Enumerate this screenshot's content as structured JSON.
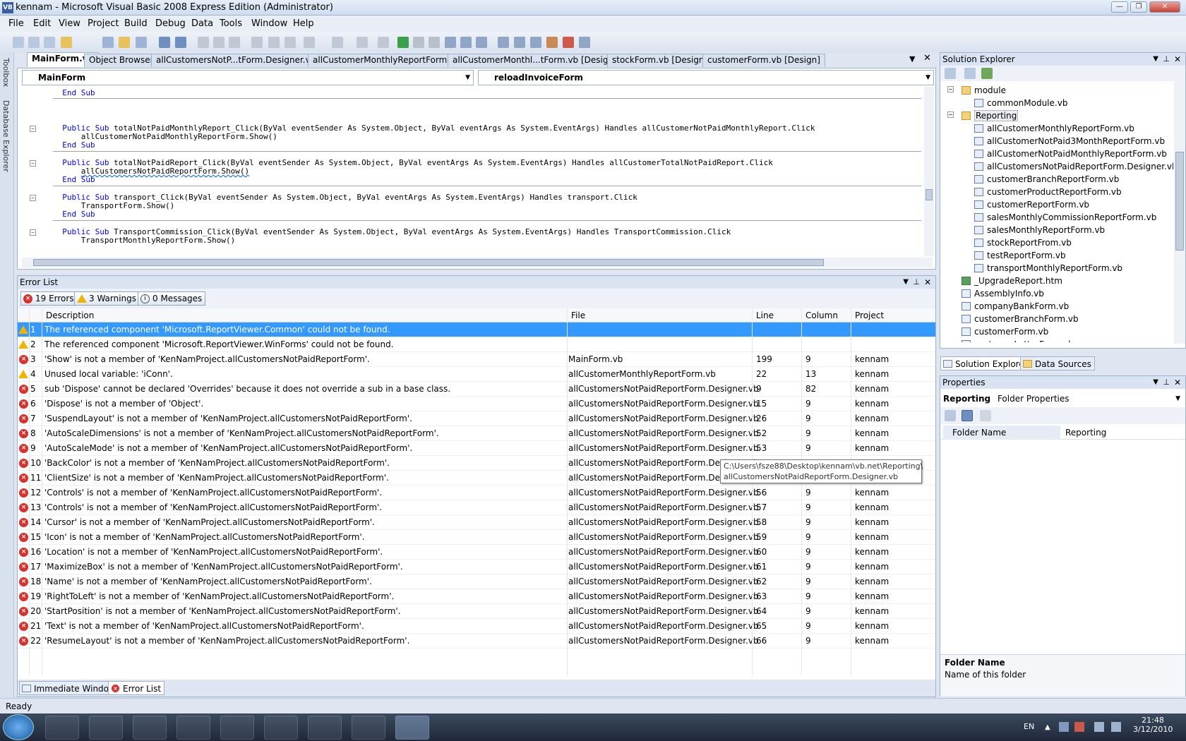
{
  "window": {
    "title": "kennam - Microsoft Visual Basic 2008 Express Edition (Administrator)",
    "app_icon": "VB",
    "minimize": "—",
    "maximize": "❐",
    "close": "✕"
  },
  "menu": [
    "File",
    "Edit",
    "View",
    "Project",
    "Build",
    "Debug",
    "Data",
    "Tools",
    "Window",
    "Help"
  ],
  "side_strip": {
    "toolbox": "Toolbox",
    "database_explorer": "Database Explorer"
  },
  "doc_tabs": [
    "MainForm.vb",
    "Object Browser",
    "allCustomersNotP...tForm.Designer.vb",
    "allCustomerMonthlyReportForm.vb",
    "allCustomerMonthl...tForm.vb [Design]",
    "stockForm.vb [Design]",
    "customerForm.vb [Design]"
  ],
  "editor": {
    "class_combo": "MainForm",
    "method_combo": "reloadInvoiceForm",
    "lines": [
      {
        "pre": "  ",
        "kw": "End Sub",
        "post": ""
      },
      {
        "pre": "  ",
        "kw": "Public Sub",
        "post": " totalNotPaidMonthlyReport_Click(ByVal eventSender As System.Object, ByVal eventArgs As System.EventArgs) Handles allCustomerNotPaidMonthlyReport.Click"
      },
      {
        "pre": "      ",
        "kw": "",
        "post": "allCustomerNotPaidMonthlyReportForm.Show()"
      },
      {
        "pre": "  ",
        "kw": "End Sub",
        "post": ""
      },
      {
        "pre": "  ",
        "kw": "Public Sub",
        "post": " totalNotPaidReport_Click(ByVal eventSender As System.Object, ByVal eventArgs As System.EventArgs) Handles allCustomerTotalNotPaidReport.Click"
      },
      {
        "pre": "      ",
        "kw": "",
        "post": "allCustomersNotPaidReportForm.Show()"
      },
      {
        "pre": "  ",
        "kw": "End Sub",
        "post": ""
      },
      {
        "pre": "  ",
        "kw": "Public Sub",
        "post": " transport_Click(ByVal eventSender As System.Object, ByVal eventArgs As System.EventArgs) Handles transport.Click"
      },
      {
        "pre": "      ",
        "kw": "",
        "post": "TransportForm.Show()"
      },
      {
        "pre": "  ",
        "kw": "End Sub",
        "post": ""
      },
      {
        "pre": "  ",
        "kw": "Public Sub",
        "post": " TransportCommission_Click(ByVal eventSender As System.Object, ByVal eventArgs As System.EventArgs) Handles TransportCommission.Click"
      },
      {
        "pre": "      ",
        "kw": "",
        "post": "TransportMonthlyReportForm.Show()"
      }
    ]
  },
  "error_list": {
    "title": "Error List",
    "filters": {
      "errors": "19 Errors",
      "warnings": "3 Warnings",
      "messages": "0 Messages"
    },
    "columns": {
      "description": "Description",
      "file": "File",
      "line": "Line",
      "column": "Column",
      "project": "Project"
    },
    "rows": [
      {
        "type": "warning",
        "n": "1",
        "desc": "The referenced component 'Microsoft.ReportViewer.Common' could not be found.",
        "file": "",
        "line": "",
        "col": "",
        "proj": ""
      },
      {
        "type": "warning",
        "n": "2",
        "desc": "The referenced component 'Microsoft.ReportViewer.WinForms' could not be found.",
        "file": "",
        "line": "",
        "col": "",
        "proj": ""
      },
      {
        "type": "error",
        "n": "3",
        "desc": "'Show' is not a member of 'KenNamProject.allCustomersNotPaidReportForm'.",
        "file": "MainForm.vb",
        "line": "199",
        "col": "9",
        "proj": "kennam"
      },
      {
        "type": "warning",
        "n": "4",
        "desc": "Unused local variable: 'iConn'.",
        "file": "allCustomerMonthlyReportForm.vb",
        "line": "22",
        "col": "13",
        "proj": "kennam"
      },
      {
        "type": "error",
        "n": "5",
        "desc": "sub 'Dispose' cannot be declared 'Overrides' because it does not override a sub in a base class.",
        "file": "allCustomersNotPaidReportForm.Designer.vb",
        "line": "9",
        "col": "82",
        "proj": "kennam"
      },
      {
        "type": "error",
        "n": "6",
        "desc": "'Dispose' is not a member of 'Object'.",
        "file": "allCustomersNotPaidReportForm.Designer.vb",
        "line": "15",
        "col": "9",
        "proj": "kennam"
      },
      {
        "type": "error",
        "n": "7",
        "desc": "'SuspendLayout' is not a member of 'KenNamProject.allCustomersNotPaidReportForm'.",
        "file": "allCustomersNotPaidReportForm.Designer.vb",
        "line": "26",
        "col": "9",
        "proj": "kennam"
      },
      {
        "type": "error",
        "n": "8",
        "desc": "'AutoScaleDimensions' is not a member of 'KenNamProject.allCustomersNotPaidReportForm'.",
        "file": "allCustomersNotPaidReportForm.Designer.vb",
        "line": "52",
        "col": "9",
        "proj": "kennam"
      },
      {
        "type": "error",
        "n": "9",
        "desc": "'AutoScaleMode' is not a member of 'KenNamProject.allCustomersNotPaidReportForm'.",
        "file": "allCustomersNotPaidReportForm.Designer.vb",
        "line": "53",
        "col": "9",
        "proj": "kennam"
      },
      {
        "type": "error",
        "n": "10",
        "desc": "'BackColor' is not a member of 'KenNamProject.allCustomersNotPaidReportForm'.",
        "file": "allCustomersNotPaidReportForm.Designer.vb",
        "line": "",
        "col": "",
        "proj": ""
      },
      {
        "type": "error",
        "n": "11",
        "desc": "'ClientSize' is not a member of 'KenNamProject.allCustomersNotPaidReportForm'.",
        "file": "allCustomersNotPaidReportForm.Designer.vb",
        "line": "",
        "col": "",
        "proj": ""
      },
      {
        "type": "error",
        "n": "12",
        "desc": "'Controls' is not a member of 'KenNamProject.allCustomersNotPaidReportForm'.",
        "file": "allCustomersNotPaidReportForm.Designer.vb",
        "line": "56",
        "col": "9",
        "proj": "kennam"
      },
      {
        "type": "error",
        "n": "13",
        "desc": "'Controls' is not a member of 'KenNamProject.allCustomersNotPaidReportForm'.",
        "file": "allCustomersNotPaidReportForm.Designer.vb",
        "line": "57",
        "col": "9",
        "proj": "kennam"
      },
      {
        "type": "error",
        "n": "14",
        "desc": "'Cursor' is not a member of 'KenNamProject.allCustomersNotPaidReportForm'.",
        "file": "allCustomersNotPaidReportForm.Designer.vb",
        "line": "58",
        "col": "9",
        "proj": "kennam"
      },
      {
        "type": "error",
        "n": "15",
        "desc": "'Icon' is not a member of 'KenNamProject.allCustomersNotPaidReportForm'.",
        "file": "allCustomersNotPaidReportForm.Designer.vb",
        "line": "59",
        "col": "9",
        "proj": "kennam"
      },
      {
        "type": "error",
        "n": "16",
        "desc": "'Location' is not a member of 'KenNamProject.allCustomersNotPaidReportForm'.",
        "file": "allCustomersNotPaidReportForm.Designer.vb",
        "line": "60",
        "col": "9",
        "proj": "kennam"
      },
      {
        "type": "error",
        "n": "17",
        "desc": "'MaximizeBox' is not a member of 'KenNamProject.allCustomersNotPaidReportForm'.",
        "file": "allCustomersNotPaidReportForm.Designer.vb",
        "line": "61",
        "col": "9",
        "proj": "kennam"
      },
      {
        "type": "error",
        "n": "18",
        "desc": "'Name' is not a member of 'KenNamProject.allCustomersNotPaidReportForm'.",
        "file": "allCustomersNotPaidReportForm.Designer.vb",
        "line": "62",
        "col": "9",
        "proj": "kennam"
      },
      {
        "type": "error",
        "n": "19",
        "desc": "'RightToLeft' is not a member of 'KenNamProject.allCustomersNotPaidReportForm'.",
        "file": "allCustomersNotPaidReportForm.Designer.vb",
        "line": "63",
        "col": "9",
        "proj": "kennam"
      },
      {
        "type": "error",
        "n": "20",
        "desc": "'StartPosition' is not a member of 'KenNamProject.allCustomersNotPaidReportForm'.",
        "file": "allCustomersNotPaidReportForm.Designer.vb",
        "line": "64",
        "col": "9",
        "proj": "kennam"
      },
      {
        "type": "error",
        "n": "21",
        "desc": "'Text' is not a member of 'KenNamProject.allCustomersNotPaidReportForm'.",
        "file": "allCustomersNotPaidReportForm.Designer.vb",
        "line": "65",
        "col": "9",
        "proj": "kennam"
      },
      {
        "type": "error",
        "n": "22",
        "desc": "'ResumeLayout' is not a member of 'KenNamProject.allCustomersNotPaidReportForm'.",
        "file": "allCustomersNotPaidReportForm.Designer.vb",
        "line": "66",
        "col": "9",
        "proj": "kennam"
      }
    ],
    "tooltip": [
      "C:\\Users\\fsze88\\Desktop\\kennam\\vb.net\\Reporting\\",
      "allCustomersNotPaidReportForm.Designer.vb"
    ],
    "bottom_tabs": {
      "immediate": "Immediate Window",
      "errors": "Error List"
    }
  },
  "solution_explorer": {
    "title": "Solution Explorer",
    "items": [
      {
        "label": "module",
        "kind": "folder",
        "depth": 1
      },
      {
        "label": "commonModule.vb",
        "kind": "file",
        "depth": 2
      },
      {
        "label": "Reporting",
        "kind": "folder",
        "depth": 1
      },
      {
        "label": "allCustomerMonthlyReportForm.vb",
        "kind": "file",
        "depth": 2
      },
      {
        "label": "allCustomerNotPaid3MonthReportForm.vb",
        "kind": "file",
        "depth": 2
      },
      {
        "label": "allCustomerNotPaidMonthlyReportForm.vb",
        "kind": "file",
        "depth": 2
      },
      {
        "label": "allCustomersNotPaidReportForm.Designer.vb",
        "kind": "file",
        "depth": 2
      },
      {
        "label": "customerBranchReportForm.vb",
        "kind": "file",
        "depth": 2
      },
      {
        "label": "customerProductReportForm.vb",
        "kind": "file",
        "depth": 2
      },
      {
        "label": "customerReportForm.vb",
        "kind": "file",
        "depth": 2
      },
      {
        "label": "salesMonthlyCommissionReportForm.vb",
        "kind": "file",
        "depth": 2
      },
      {
        "label": "salesMonthlyReportForm.vb",
        "kind": "file",
        "depth": 2
      },
      {
        "label": "stockReportFrom.vb",
        "kind": "file",
        "depth": 2
      },
      {
        "label": "testReportForm.vb",
        "kind": "file",
        "depth": 2
      },
      {
        "label": "transportMonthlyReportForm.vb",
        "kind": "file",
        "depth": 2
      },
      {
        "label": "_UpgradeReport.htm",
        "kind": "htm",
        "depth": 1
      },
      {
        "label": "AssemblyInfo.vb",
        "kind": "file",
        "depth": 1
      },
      {
        "label": "companyBankForm.vb",
        "kind": "file",
        "depth": 1
      },
      {
        "label": "customerBranchForm.vb",
        "kind": "file",
        "depth": 1
      },
      {
        "label": "customerForm.vb",
        "kind": "file",
        "depth": 1
      },
      {
        "label": "customerLetterForm.vb",
        "kind": "file",
        "depth": 1
      }
    ],
    "tabs": {
      "solution": "Solution Explorer",
      "data": "Data Sources"
    }
  },
  "properties": {
    "title": "Properties",
    "object": "Reporting",
    "object_type": "Folder Properties",
    "rows": [
      {
        "name": "Folder Name",
        "value": "Reporting"
      }
    ],
    "desc_title": "Folder Name",
    "desc_text": "Name of this folder"
  },
  "status": {
    "text": "Ready"
  },
  "taskbar": {
    "lang": "EN",
    "time": "21:48",
    "date": "3/12/2010"
  },
  "colors": {
    "selection": "#3399ff",
    "error": "#d9302b",
    "warning": "#f0b400",
    "keyword": "#0000ff"
  }
}
